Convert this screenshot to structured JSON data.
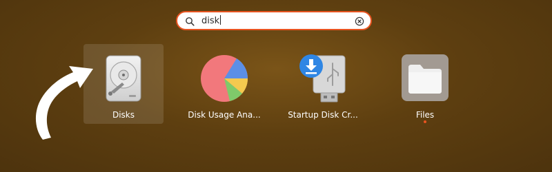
{
  "search": {
    "query": "disk",
    "icon": "search-icon",
    "clear_icon": "clear-icon",
    "accent_color": "#e95420"
  },
  "apps": [
    {
      "label": "Disks",
      "icon": "disks-icon",
      "selected": true
    },
    {
      "label": "Disk Usage Ana...",
      "icon": "disk-usage-analyzer-icon"
    },
    {
      "label": "Startup Disk Cr...",
      "icon": "startup-disk-creator-icon"
    },
    {
      "label": "Files",
      "icon": "files-icon",
      "running": true
    }
  ],
  "annotation": {
    "icon": "curved-arrow-icon",
    "color": "#ffffff"
  }
}
